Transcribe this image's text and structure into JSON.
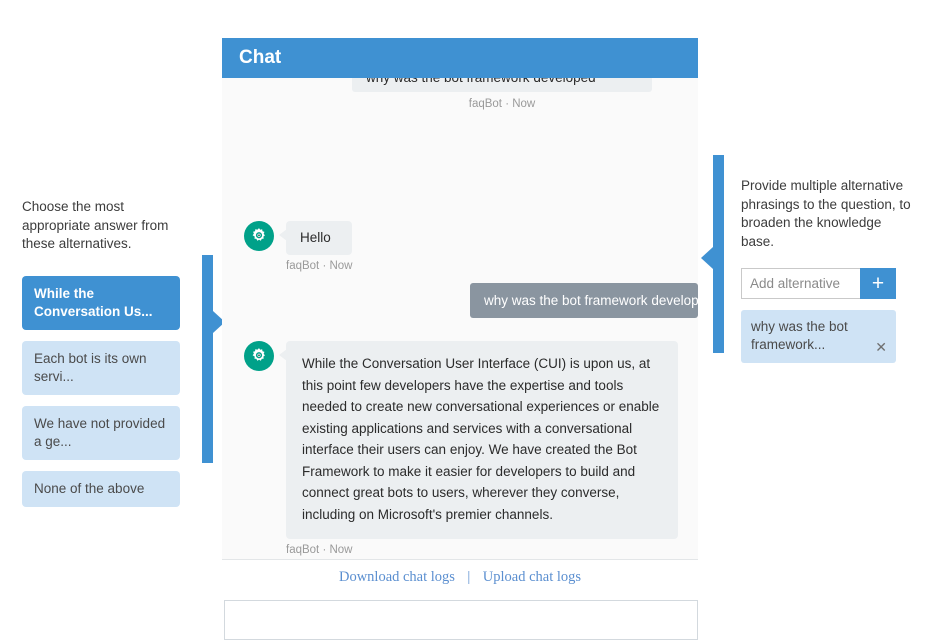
{
  "left_annotation": {
    "instruction": "Choose the most appropriate answer from these alternatives.",
    "alternatives": [
      {
        "label": "While the Conversation Us...",
        "selected": true
      },
      {
        "label": "Each bot is its own servi...",
        "selected": false
      },
      {
        "label": "We have not provided a ge...",
        "selected": false
      },
      {
        "label": "None of the above",
        "selected": false
      }
    ]
  },
  "right_annotation": {
    "instruction": "Provide multiple alternative phrasings to the question, to broaden the knowledge base.",
    "add_input_placeholder": "Add alternative",
    "add_input_value": "",
    "add_button_label": "+",
    "chips": [
      {
        "text": "why was the bot framework...",
        "close_label": "✕"
      }
    ]
  },
  "chat": {
    "header_title": "Chat",
    "clipped_message": {
      "text": "why was the bot framework developed",
      "meta": "faqBot · Now"
    },
    "messages": [
      {
        "id": "bot-hello",
        "sender": "bot",
        "text": "Hello",
        "meta": "faqBot · Now",
        "avatar_icon": "gear-icon"
      },
      {
        "id": "user-question",
        "sender": "user",
        "text": "why was the bot framework developed"
      },
      {
        "id": "bot-answer",
        "sender": "bot",
        "text": "While the Conversation User Interface (CUI) is upon us, at this point few developers have the expertise and tools needed to create new conversational experiences or enable existing applications and services with a conversational interface their users can enjoy. We have created the Bot Framework to make it easier for developers to build and connect great bots to users, wherever they converse, including on Microsoft's premier channels.",
        "meta": "faqBot · Now",
        "avatar_icon": "gear-icon"
      }
    ],
    "footer": {
      "download_label": "Download chat logs",
      "separator": "|",
      "upload_label": "Upload chat logs"
    },
    "composer": {
      "value": "",
      "placeholder": ""
    }
  },
  "colors": {
    "accent_blue": "#3f91d2",
    "chip_blue": "#cfe3f5",
    "bot_avatar_teal": "#00a189",
    "user_bubble_gray": "#8a95a0",
    "bot_bubble_gray": "#eceff1",
    "link_blue": "#5b8fd0"
  }
}
